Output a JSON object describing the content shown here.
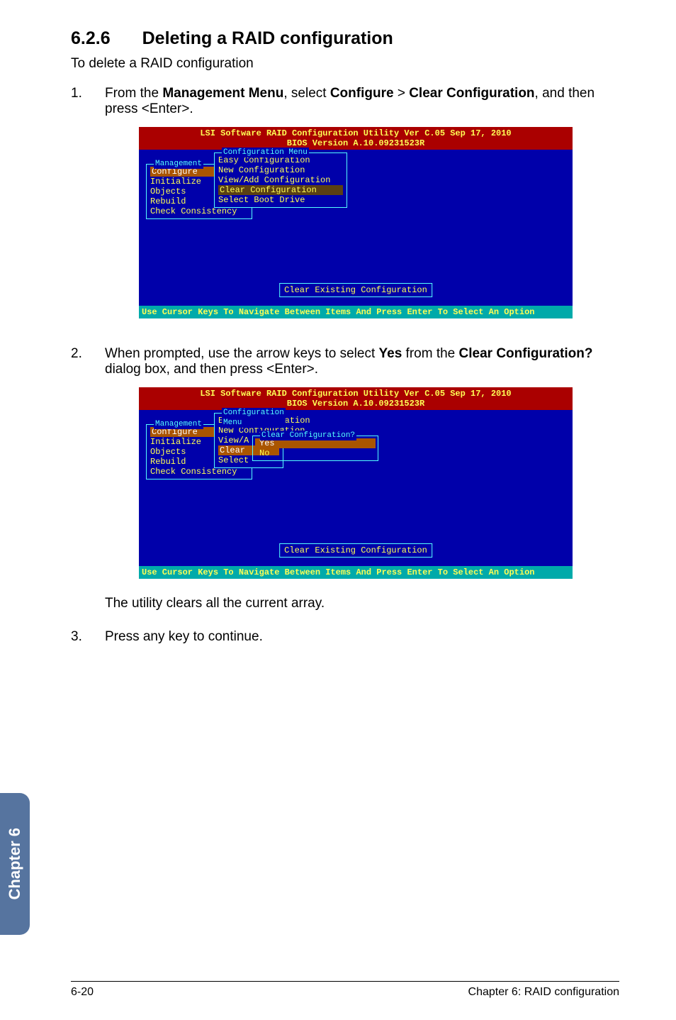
{
  "section": {
    "number": "6.2.6",
    "title": "Deleting a RAID configuration"
  },
  "intro": "To delete a RAID configuration",
  "step1": {
    "num": "1.",
    "text_a": "From the ",
    "bold_a": "Management Menu",
    "text_b": ", select ",
    "bold_b": "Configure",
    "text_c": " > ",
    "bold_c": "Clear Configuration",
    "text_d": ", and then press <Enter>."
  },
  "step2": {
    "num": "2.",
    "text_a": "When prompted, use the arrow keys to select ",
    "bold_a": "Yes",
    "text_b": " from the ",
    "bold_b": "Clear Configuration?",
    "text_c": " dialog box, and then press <Enter>."
  },
  "step3_pre": "The utility clears all the current array.",
  "step3": {
    "num": "3.",
    "text": "Press any key to continue."
  },
  "dos": {
    "title_line1": "LSI Software RAID Configuration Utility Ver C.05 Sep 17, 2010",
    "title_line2": "BIOS Version  A.10.09231523R",
    "mgmt_label": "Management",
    "mgmt_items": {
      "configure": "Configure",
      "initialize": "Initialize",
      "objects": "Objects",
      "rebuild": "Rebuild",
      "check": "Check Consistency"
    },
    "cfg_label": "Configuration Menu",
    "cfg_items": {
      "easy": "Easy Configuration",
      "newcfg": "New Configuration",
      "viewadd": "View/Add Configuration",
      "clear": "Clear Configuration",
      "boot": "Select Boot Drive"
    },
    "cfg_items_short": {
      "viewadd": "View/A",
      "clear": "Clear",
      "boot": "Select"
    },
    "clear_q_label": "Clear Configuration?",
    "clear_q": {
      "yes": "Yes",
      "no": "No"
    },
    "status": "Clear Existing Configuration",
    "hint": "Use Cursor Keys To Navigate Between Items And Press Enter To Select An Option"
  },
  "sidetab": "Chapter 6",
  "footer": {
    "left": "6-20",
    "right": "Chapter 6: RAID configuration"
  }
}
